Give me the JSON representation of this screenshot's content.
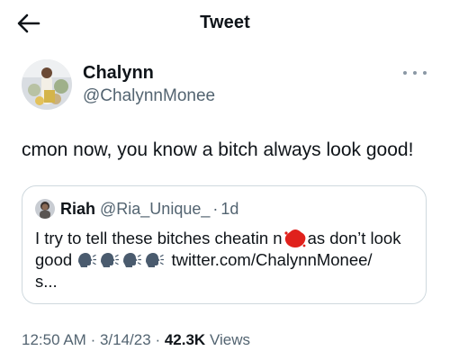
{
  "header": {
    "back_icon": "arrow-left-icon",
    "title": "Tweet"
  },
  "tweet": {
    "author_name": "Chalynn",
    "author_handle": "@ChalynnMonee",
    "text": "cmon now, you know a bitch always look good!",
    "more_icon": "more-horizontal-icon"
  },
  "quoted_tweet": {
    "author_name": "Riah",
    "author_handle": "@Ria_Unique_",
    "separator": "·",
    "time": "1d",
    "text_before": "I try to tell these bitches cheatin n",
    "text_after": "as don’t look",
    "line2_start": "good",
    "emoji": "speaking-head-icon",
    "emoji_count": 4,
    "link": "twitter.com/ChalynnMonee/",
    "line3": "s..."
  },
  "footer": {
    "time": "12:50 AM",
    "sep1": "·",
    "date": "3/14/23",
    "sep2": "·",
    "views_count": "42.3K",
    "views_label": "Views"
  },
  "colors": {
    "text": "#0f1419",
    "secondary": "#536471",
    "border": "#cfd9de",
    "censor": "#e0211c"
  }
}
